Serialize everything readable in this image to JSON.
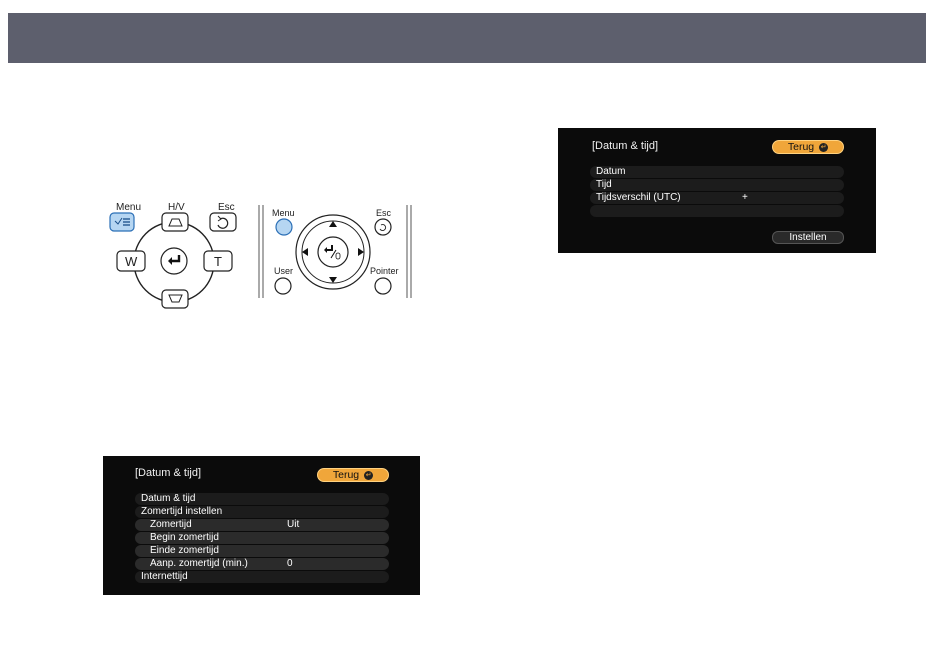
{
  "remote": {
    "left": {
      "menu_label": "Menu",
      "hv_label": "H/V",
      "esc_label": "Esc",
      "w_label": "W",
      "t_label": "T"
    },
    "right": {
      "menu_label": "Menu",
      "esc_label": "Esc",
      "user_label": "User",
      "pointer_label": "Pointer"
    }
  },
  "screen_main": {
    "title": "[Datum & tijd]",
    "back_label": "Terug",
    "rows": [
      {
        "label": "Datum & tijd",
        "value": ""
      },
      {
        "label": "Zomertijd instellen",
        "value": ""
      },
      {
        "label": "Zomertijd",
        "value": "Uit"
      },
      {
        "label": "Begin zomertijd",
        "value": ""
      },
      {
        "label": "Einde zomertijd",
        "value": ""
      },
      {
        "label": "Aanp. zomertijd (min.)",
        "value": "0"
      },
      {
        "label": "Internettijd",
        "value": ""
      }
    ]
  },
  "screen_datetime": {
    "title": "[Datum & tijd]",
    "back_label": "Terug",
    "rows": [
      {
        "label": "Datum",
        "value": ""
      },
      {
        "label": "Tijd",
        "value": ""
      },
      {
        "label": "Tijdsverschil (UTC)",
        "value": "+"
      },
      {
        "label": "",
        "value": ""
      }
    ],
    "set_label": "Instellen"
  }
}
